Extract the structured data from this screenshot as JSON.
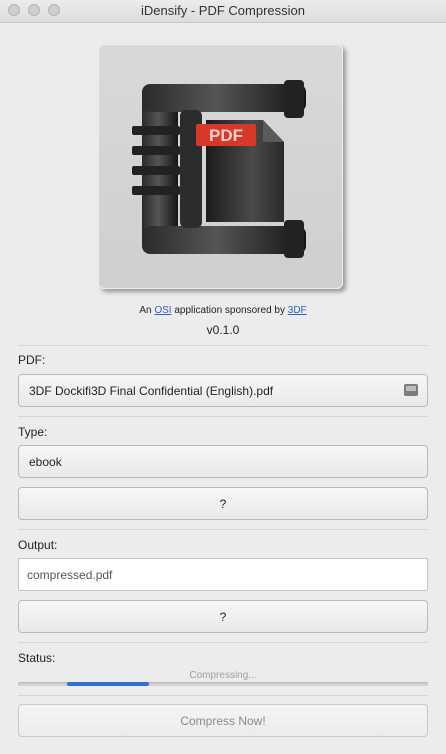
{
  "window": {
    "title": "iDensify - PDF Compression"
  },
  "logo": {
    "badge_text": "PDF"
  },
  "about": {
    "prefix": "An",
    "org_link": "OSI",
    "middle": "application sponsored by",
    "sponsor_link": "3DF",
    "version": "v0.1.0"
  },
  "pdf": {
    "label": "PDF:",
    "file_name": "3DF Dockifi3D Final Confidential (English).pdf"
  },
  "type": {
    "label": "Type:",
    "selected": "ebook",
    "help_label": "?"
  },
  "output": {
    "label": "Output:",
    "file_name": "compressed.pdf",
    "help_label": "?"
  },
  "status": {
    "label": "Status:",
    "text": "Compressing...",
    "progress_start": 0.12,
    "progress_end": 0.32
  },
  "actions": {
    "compress_label": "Compress Now!"
  },
  "colors": {
    "accent": "#2f6fd0",
    "link": "#2e62c8",
    "logo_badge": "#d7382a"
  }
}
